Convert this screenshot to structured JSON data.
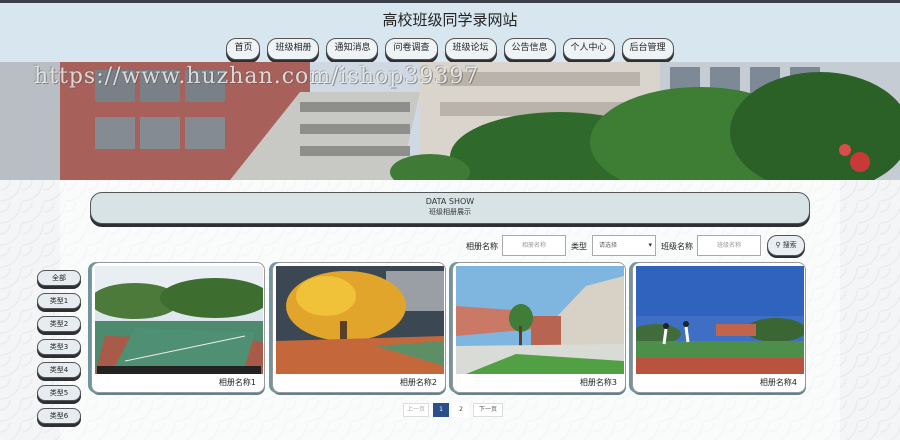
{
  "site": {
    "title": "高校班级同学录网站"
  },
  "nav": [
    {
      "label": "首页"
    },
    {
      "label": "班级相册"
    },
    {
      "label": "通知消息"
    },
    {
      "label": "问卷调查"
    },
    {
      "label": "班级论坛"
    },
    {
      "label": "公告信息"
    },
    {
      "label": "个人中心"
    },
    {
      "label": "后台管理"
    }
  ],
  "banner": {
    "watermark": "https://www.huzhan.com/ishop39397"
  },
  "section": {
    "title_en": "DATA SHOW",
    "title_cn": "班级相册展示"
  },
  "search": {
    "album_label": "相册名称",
    "album_placeholder": "相册名称",
    "type_label": "类型",
    "type_selected": "请选择",
    "class_label": "班级名称",
    "class_placeholder": "班级名称",
    "button_label": "搜索"
  },
  "categories": [
    {
      "label": "全部"
    },
    {
      "label": "类型1"
    },
    {
      "label": "类型2"
    },
    {
      "label": "类型3"
    },
    {
      "label": "类型4"
    },
    {
      "label": "类型5"
    },
    {
      "label": "类型6"
    }
  ],
  "albums": [
    {
      "name": "相册名称1"
    },
    {
      "name": "相册名称2"
    },
    {
      "name": "相册名称3"
    },
    {
      "name": "相册名称4"
    }
  ],
  "pagination": {
    "prev": "上一页",
    "pages": [
      "1",
      "2"
    ],
    "current": "1",
    "next": "下一页"
  },
  "colors": {
    "topbar": "#d8e6ef",
    "button_shadow": "#2d2f33",
    "card_accent": "#6f96a0",
    "page_active": "#2a4f8a"
  }
}
